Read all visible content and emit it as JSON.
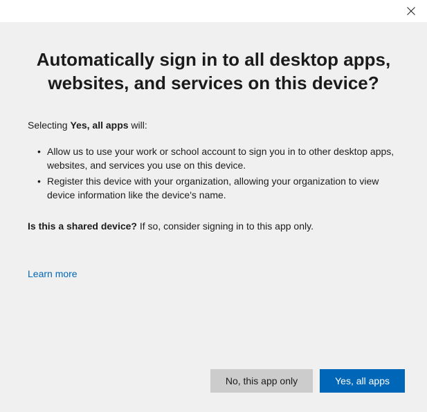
{
  "heading": "Automatically sign in to all desktop apps, websites, and services on this device?",
  "intro": {
    "prefix": "Selecting ",
    "bold": "Yes, all apps",
    "suffix": " will:"
  },
  "bullets": [
    "Allow us to use your work or school account to sign you in to other desktop apps, websites, and services you use on this device.",
    "Register this device with your organization, allowing your organization to view device information like the device's name."
  ],
  "shared": {
    "bold": "Is this a shared device?",
    "rest": " If so, consider signing in to this app only."
  },
  "learn_more": "Learn more",
  "buttons": {
    "secondary": "No, this app only",
    "primary": "Yes, all apps"
  }
}
